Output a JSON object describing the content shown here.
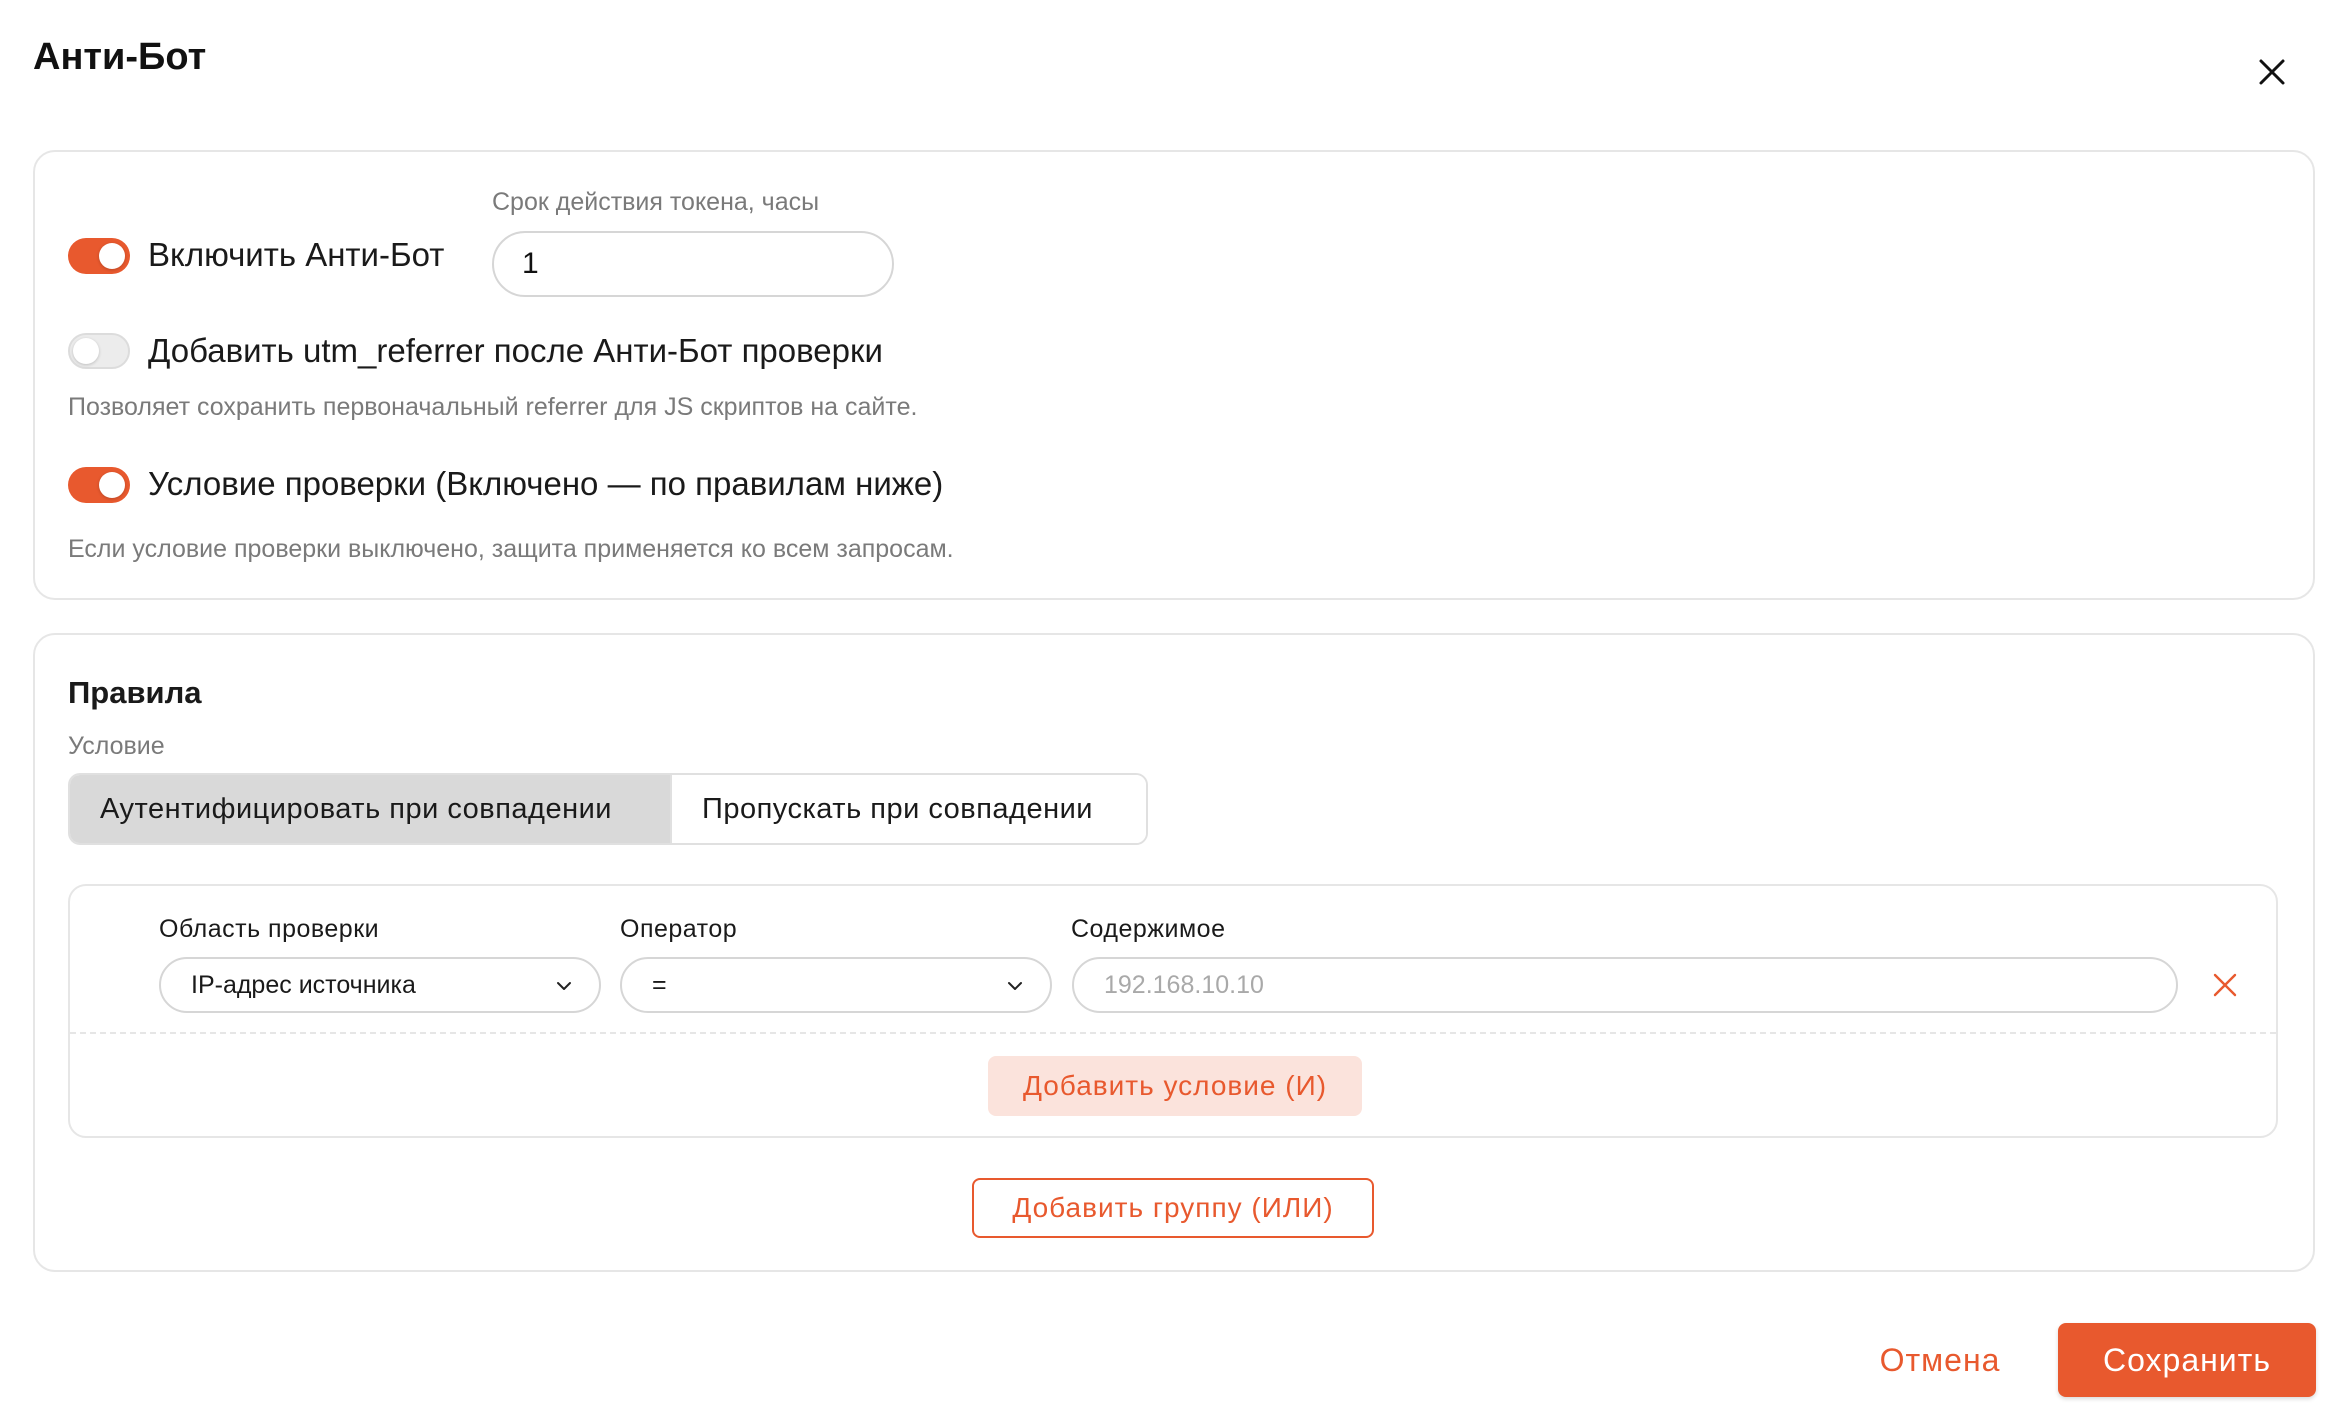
{
  "dialog": {
    "title": "Анти-Бот",
    "close_icon": "close-icon"
  },
  "settings": {
    "enable_antibot": {
      "label": "Включить Анти-Бот",
      "checked": true
    },
    "token_lifetime": {
      "label": "Срок действия токена, часы",
      "value": "1"
    },
    "utm_referrer": {
      "label": "Добавить utm_referrer после Анти-Бот проверки",
      "checked": false,
      "hint": "Позволяет сохранить первоначальный referrer для JS скриптов на сайте."
    },
    "check_condition": {
      "label": "Условие проверки (Включено — по правилам ниже)",
      "checked": true,
      "hint": "Если условие проверки выключено, защита применяется ко всем запросам."
    }
  },
  "rules": {
    "title": "Правила",
    "condition_label": "Условие",
    "condition_options": [
      "Аутентифицировать при совпадении",
      "Пропускать при совпадении"
    ],
    "condition_selected": "Аутентифицировать при совпадении",
    "group": {
      "scope_label": "Область проверки",
      "scope_value": "IP-адрес источника",
      "operator_label": "Оператор",
      "operator_value": "=",
      "content_label": "Содержимое",
      "content_placeholder": "192.168.10.10",
      "content_value": "",
      "add_condition_label": "Добавить условие (И)"
    },
    "add_group_label": "Добавить группу (ИЛИ)"
  },
  "footer": {
    "cancel_label": "Отмена",
    "save_label": "Сохранить"
  },
  "colors": {
    "accent": "#e8592e",
    "accent_soft": "#fbe3dc",
    "border": "#e6e6e6",
    "muted_text": "#7a7a7a"
  }
}
